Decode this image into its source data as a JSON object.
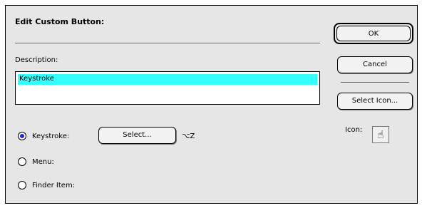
{
  "dialog": {
    "title": "Edit Custom Button:",
    "description_label": "Description:",
    "description_value": "Keystroke"
  },
  "options": {
    "keystroke_label": "Keystroke:",
    "menu_label": "Menu:",
    "finder_item_label": "Finder Item:",
    "selected": "Keystroke",
    "select_button": "Select...",
    "shortcut": "⌥Z"
  },
  "side": {
    "ok_label": "OK",
    "cancel_label": "Cancel",
    "select_icon_label": "Select Icon...",
    "icon_label": "Icon:",
    "icon_glyph": "☝"
  }
}
